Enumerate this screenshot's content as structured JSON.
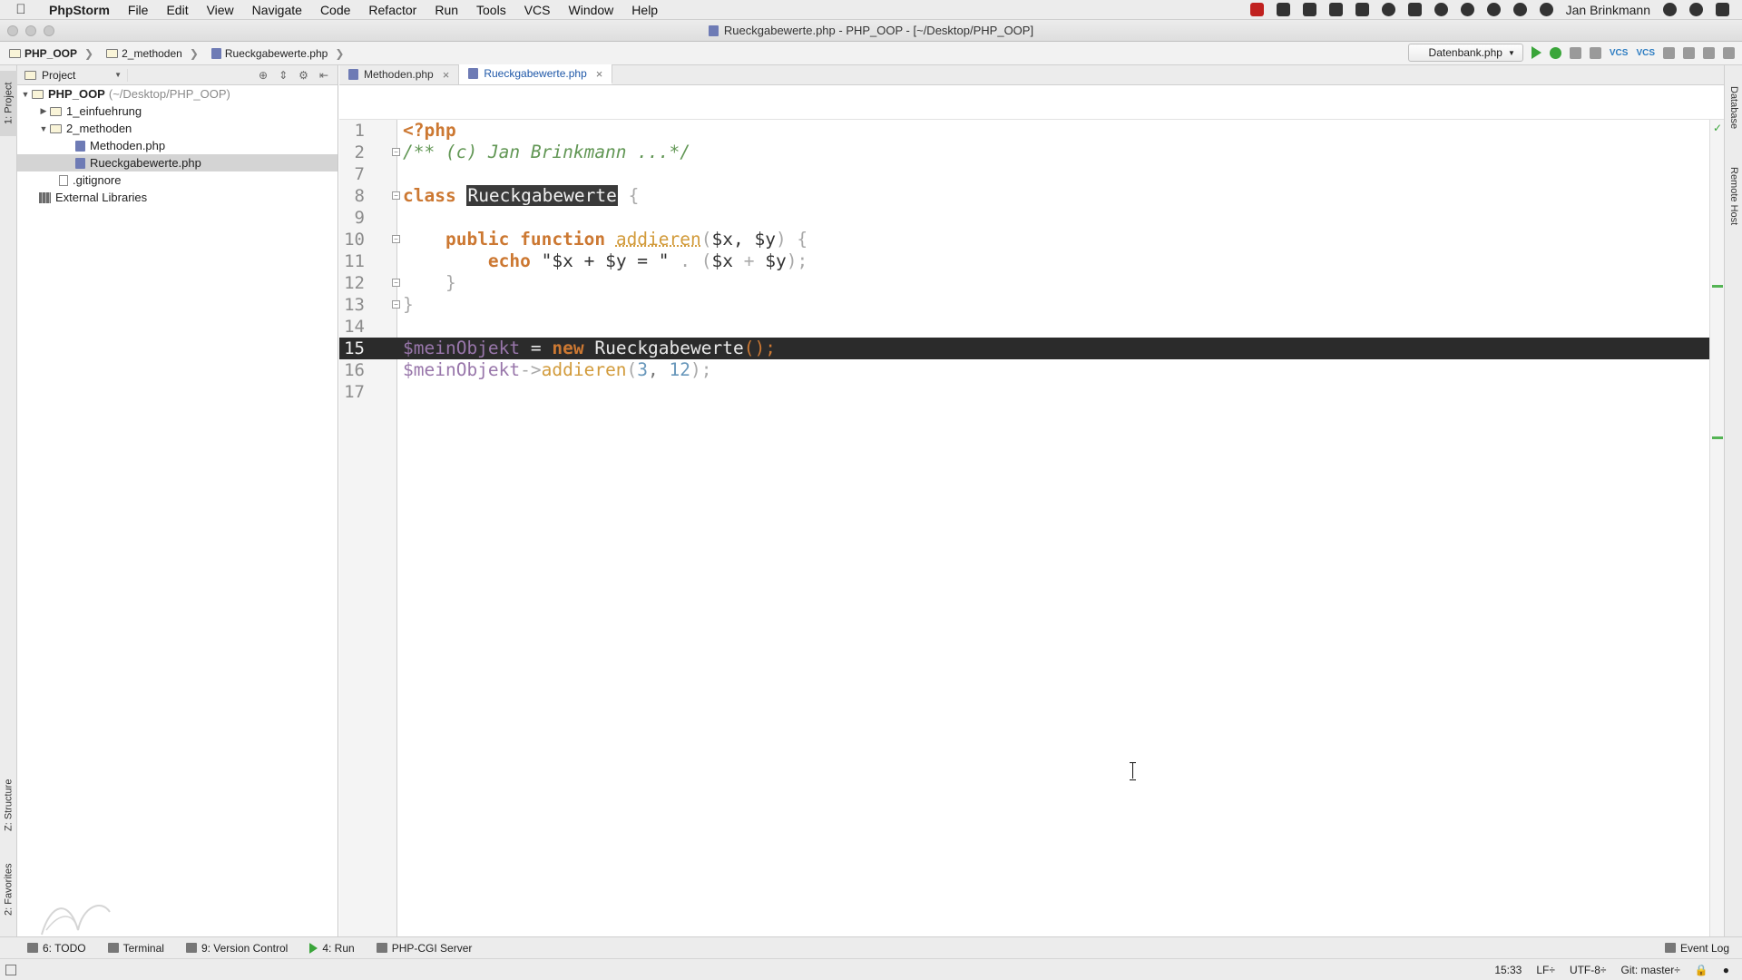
{
  "menubar": {
    "app_name": "PhpStorm",
    "items": [
      "File",
      "Edit",
      "View",
      "Navigate",
      "Code",
      "Refactor",
      "Run",
      "Tools",
      "VCS",
      "Window",
      "Help"
    ],
    "user": "Jan Brinkmann"
  },
  "window": {
    "title": "Rueckgabewerte.php - PHP_OOP - [~/Desktop/PHP_OOP]"
  },
  "navbar": {
    "breadcrumbs": [
      "PHP_OOP",
      "2_methoden",
      "Rueckgabewerte.php"
    ],
    "run_config": "Datenbank.php"
  },
  "left_strip": {
    "project_tab": "1: Project",
    "structure_tab": "Z: Structure",
    "favorites_tab": "2: Favorites"
  },
  "right_strip": {
    "database_tab": "Database",
    "remote_tab": "Remote Host"
  },
  "project_panel": {
    "view_selector": "Project",
    "tree": [
      {
        "label": "PHP_OOP",
        "hint": "(~/Desktop/PHP_OOP)",
        "type": "folder"
      },
      {
        "label": "1_einfuehrung",
        "type": "folder"
      },
      {
        "label": "2_methoden",
        "type": "folder"
      },
      {
        "label": "Methoden.php",
        "type": "php"
      },
      {
        "label": "Rueckgabewerte.php",
        "type": "php"
      },
      {
        "label": ".gitignore",
        "type": "file"
      },
      {
        "label": "External Libraries",
        "type": "library"
      }
    ]
  },
  "editor_tabs": [
    {
      "label": "Methoden.php",
      "active": false
    },
    {
      "label": "Rueckgabewerte.php",
      "active": true
    }
  ],
  "editor": {
    "current_line": 15,
    "line_numbers": [
      "1",
      "2",
      "7",
      "8",
      "9",
      "10",
      "11",
      "12",
      "13",
      "14",
      "15",
      "16",
      "17"
    ],
    "code": {
      "l1_tag": "<?php",
      "l2_comment": "/** (c) Jan Brinkmann ...*/",
      "l8_kw": "class",
      "l8_name": "Rueckgabewerte",
      "l8_brace": "{",
      "l10_kw": "public function",
      "l10_fn": "addieren",
      "l10_open": "(",
      "l10_x": "$x",
      "l10_comma": ", ",
      "l10_y": "$y",
      "l10_close": ") {",
      "l11_kw": "echo",
      "l11_str": "\"$x + $y = \"",
      "l11_dot": " . ",
      "l11_open": "(",
      "l11_x": "$x",
      "l11_plus": " + ",
      "l11_y": "$y",
      "l11_close": ");",
      "l12_brace": "}",
      "l13_brace": "}",
      "l15_var": "$meinObjekt",
      "l15_eq": " = ",
      "l15_new": "new",
      "l15_cls": "Rueckgabewerte",
      "l15_paren": "();",
      "l16_var": "$meinObjekt",
      "l16_arrow": "->",
      "l16_fn": "addieren",
      "l16_open": "(",
      "l16_n1": "3",
      "l16_comma": ", ",
      "l16_n2": "12",
      "l16_close": ");"
    }
  },
  "bottom_bar": {
    "todo": "6: TODO",
    "terminal": "Terminal",
    "version_control": "9: Version Control",
    "run": "4: Run",
    "php_cgi": "PHP-CGI Server",
    "event_log": "Event Log"
  },
  "status_bar": {
    "position": "15:33",
    "line_sep": "LF÷",
    "encoding": "UTF-8÷",
    "git": "Git: master÷"
  },
  "colors": {
    "keyword": "#cc7832",
    "comment": "#629755",
    "variable": "#9876aa",
    "function": "#d29b3b",
    "number": "#6897bb",
    "current_line_bg": "#2b2b2b",
    "run_green": "#3aa53a"
  }
}
